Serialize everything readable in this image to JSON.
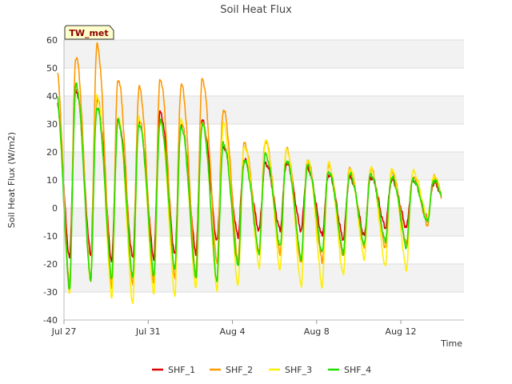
{
  "chart_data": {
    "type": "line",
    "title": "Soil Heat Flux",
    "xlabel": "Time",
    "ylabel": "Soil Heat Flux (W/m2)",
    "station_label": "TW_met",
    "ylim": [
      -40,
      60
    ],
    "yticks": [
      -40,
      -30,
      -20,
      -10,
      0,
      10,
      20,
      30,
      40,
      50,
      60
    ],
    "xlim": [
      "2024-07-27",
      "2024-08-15"
    ],
    "xticks": [
      {
        "date": "2024-07-27",
        "label": "Jul 27"
      },
      {
        "date": "2024-07-31",
        "label": "Jul 31"
      },
      {
        "date": "2024-08-04",
        "label": "Aug 4"
      },
      {
        "date": "2024-08-08",
        "label": "Aug 8"
      },
      {
        "date": "2024-08-12",
        "label": "Aug 12"
      }
    ],
    "grid": true,
    "legend_position": "bottom",
    "day_dates": [
      "2024-07-27",
      "2024-07-28",
      "2024-07-29",
      "2024-07-30",
      "2024-07-31",
      "2024-08-01",
      "2024-08-02",
      "2024-08-03",
      "2024-08-04",
      "2024-08-05",
      "2024-08-06",
      "2024-08-07",
      "2024-08-08",
      "2024-08-09",
      "2024-08-10",
      "2024-08-11",
      "2024-08-12",
      "2024-08-13"
    ],
    "series": [
      {
        "name": "SHF_1",
        "color": "#dd0000",
        "daily_max": [
          42,
          39,
          31,
          31,
          34,
          30,
          31,
          22,
          17,
          16,
          16,
          14,
          12,
          11,
          11,
          10,
          10,
          9
        ],
        "daily_min": [
          -18,
          -17,
          -19,
          -18,
          -18,
          -17,
          -16,
          -12,
          -10,
          -8,
          -8,
          -8,
          -10,
          -11,
          -10,
          -7,
          -7,
          -4
        ]
      },
      {
        "name": "SHF_2",
        "color": "#ff9900",
        "daily_max": [
          54,
          58,
          46,
          43,
          46,
          44,
          46,
          35,
          23,
          24,
          21,
          17,
          15,
          14,
          14,
          13,
          11,
          11
        ],
        "daily_min": [
          -28,
          -26,
          -29,
          -27,
          -27,
          -25,
          -24,
          -20,
          -19,
          -16,
          -16,
          -20,
          -19,
          -17,
          -14,
          -14,
          -13,
          -6
        ]
      },
      {
        "name": "SHF_3",
        "color": "#ffee00",
        "daily_max": [
          44,
          40,
          32,
          32,
          31,
          31,
          31,
          30,
          22,
          24,
          21,
          17,
          16,
          14,
          14,
          14,
          13,
          11
        ],
        "daily_min": [
          -30,
          -26,
          -32,
          -34,
          -31,
          -31,
          -29,
          -29,
          -28,
          -21,
          -22,
          -28,
          -28,
          -24,
          -18,
          -21,
          -22,
          -4
        ]
      },
      {
        "name": "SHF_4",
        "color": "#22dd00",
        "daily_max": [
          44,
          36,
          31,
          30,
          31,
          29,
          30,
          23,
          17,
          19,
          17,
          15,
          13,
          12,
          12,
          11,
          10,
          10
        ],
        "daily_min": [
          -29,
          -26,
          -25,
          -25,
          -24,
          -22,
          -25,
          -26,
          -21,
          -16,
          -14,
          -18,
          -16,
          -16,
          -13,
          -12,
          -14,
          -5
        ]
      }
    ]
  }
}
